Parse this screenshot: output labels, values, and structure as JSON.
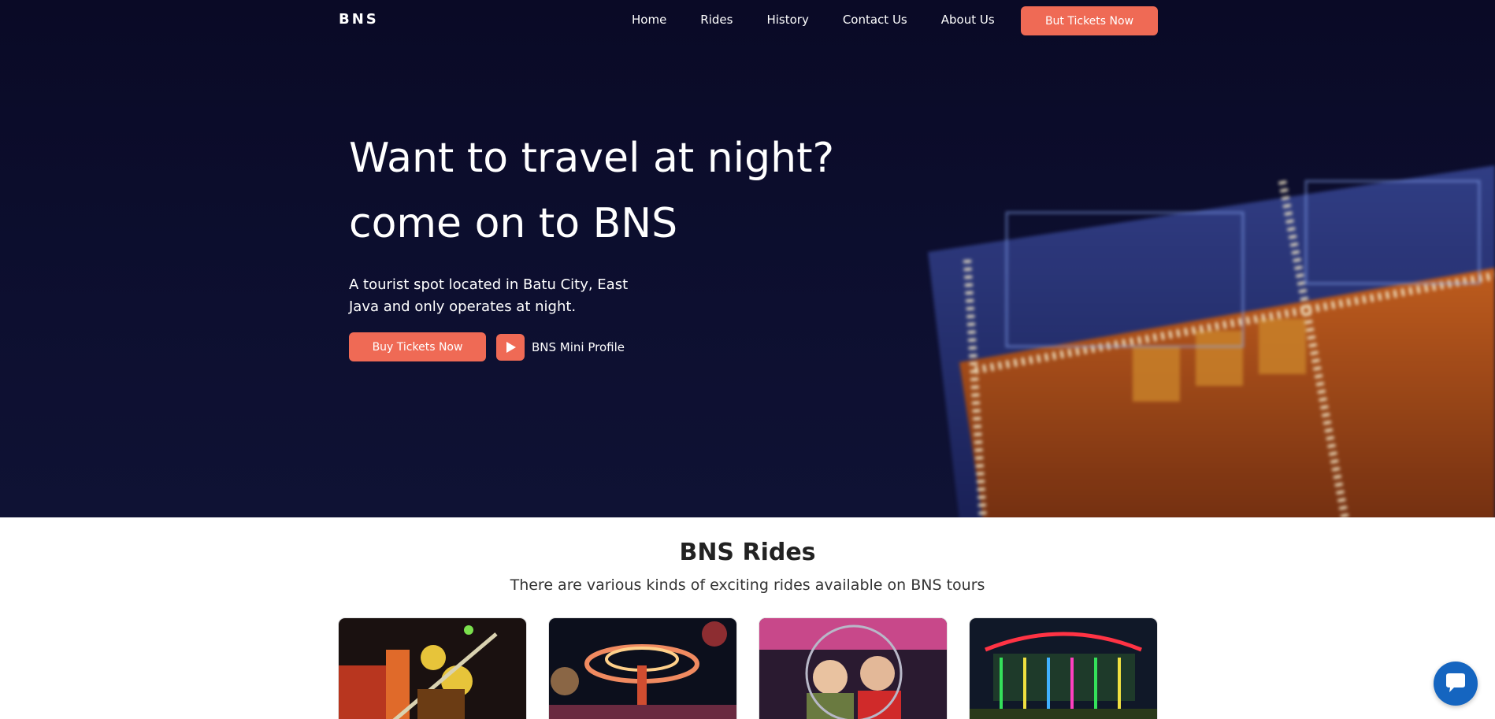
{
  "nav": {
    "logo": "BNS",
    "links": [
      "Home",
      "Rides",
      "History",
      "Contact Us",
      "About Us"
    ],
    "cta": "But Tickets Now"
  },
  "hero": {
    "title_line1": "Want to travel at night?",
    "title_line2": "come on to BNS",
    "subtitle": "A tourist spot located in Batu City, East Java and only operates at night.",
    "buy_button": "Buy Tickets Now",
    "profile_link": "BNS Mini Profile"
  },
  "rides": {
    "title": "BNS Rides",
    "subtitle": "There are various kinds of exciting rides available on BNS tours"
  },
  "colors": {
    "accent": "#ef6a55",
    "hero_bg": "#0b0c2d",
    "chat": "#1565c0"
  },
  "icons": {
    "play": "play-icon",
    "chat": "chat-bubble-icon"
  }
}
